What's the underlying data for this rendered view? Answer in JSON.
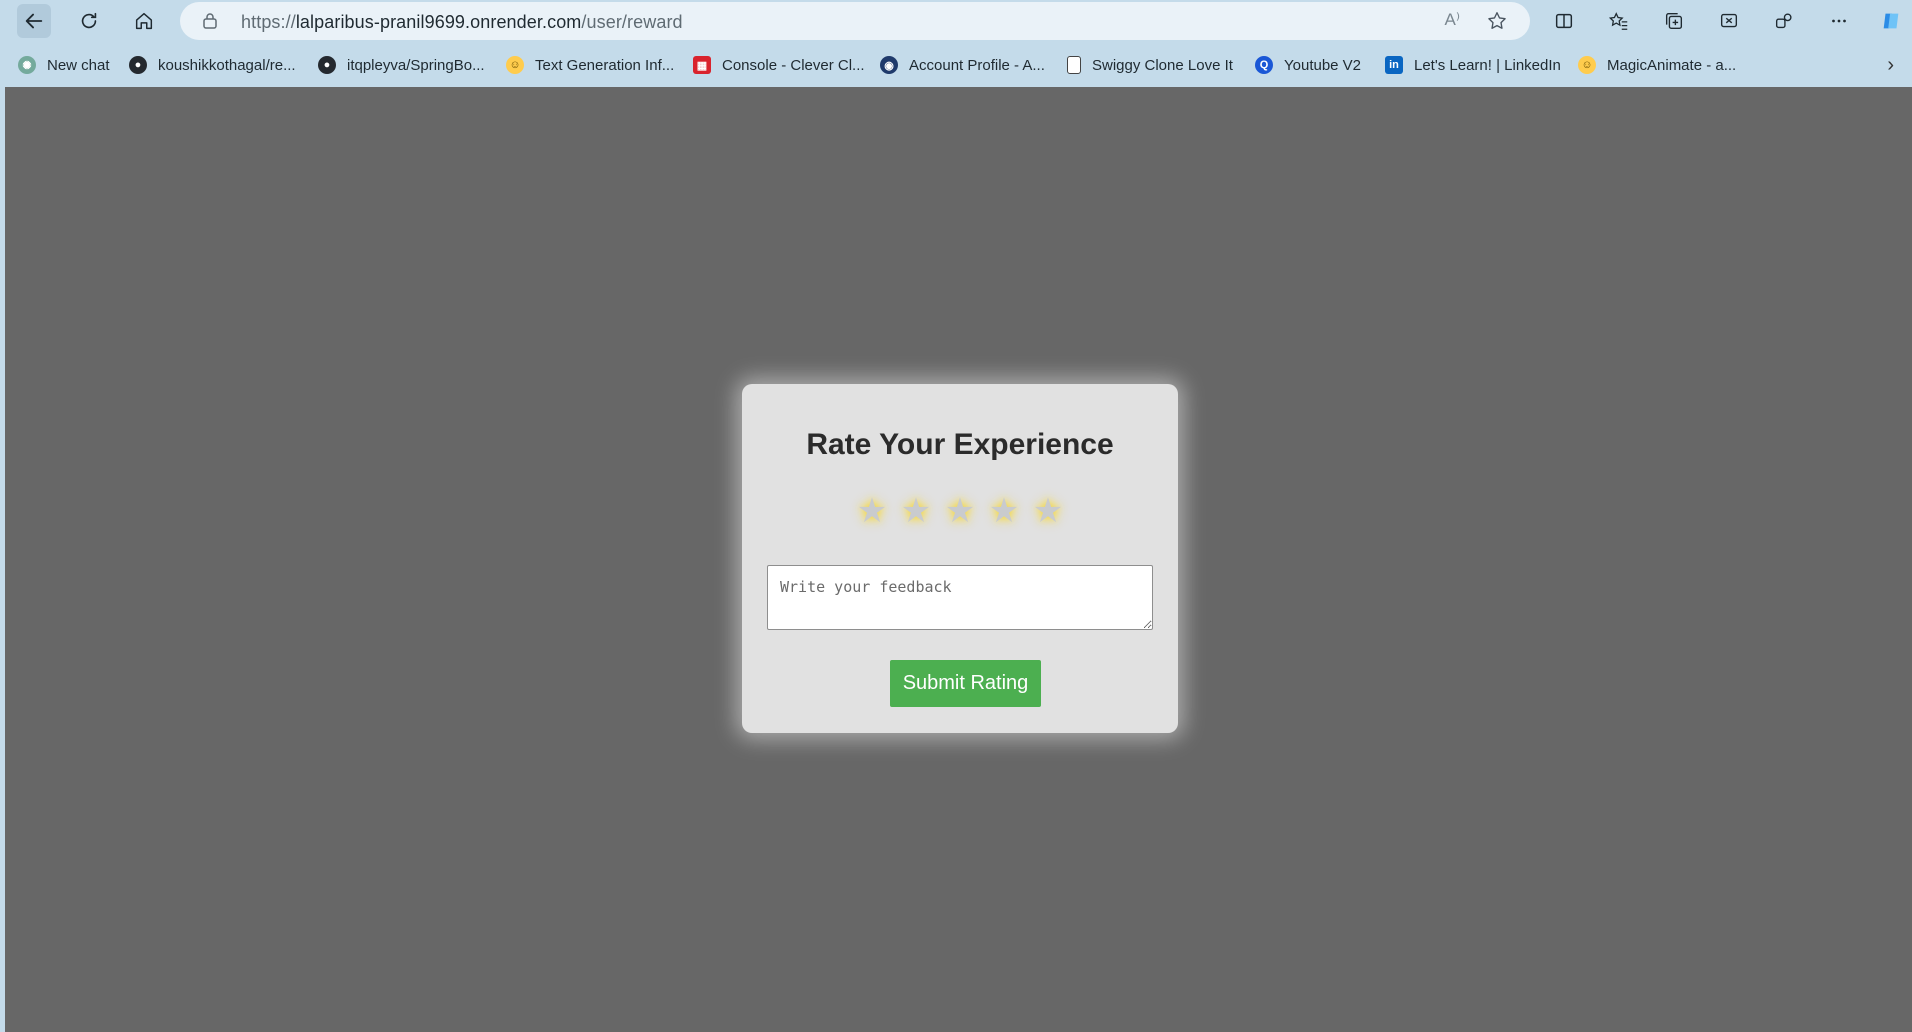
{
  "browser": {
    "url_scheme": "https://",
    "url_host": "lalparibus-pranil9699.onrender.com",
    "url_path": "/user/reward",
    "read_aloud_label": "A⁾",
    "icons": [
      "back-icon",
      "refresh-icon",
      "home-icon",
      "lock-icon",
      "read-aloud-icon",
      "favorite-star-icon",
      "split-screen-icon",
      "favorites-icon",
      "collections-icon",
      "screenshot-icon",
      "extensions-icon",
      "more-icon",
      "copilot-icon"
    ]
  },
  "bookmarks": [
    {
      "label": "New chat",
      "icon": "chatgpt-icon",
      "color": "#74aa9c"
    },
    {
      "label": "koushikkothagal/re...",
      "icon": "github-icon",
      "color": "#24292f"
    },
    {
      "label": "itqpleyva/SpringBo...",
      "icon": "github-icon",
      "color": "#24292f"
    },
    {
      "label": "Text Generation Inf...",
      "icon": "huggingface-icon",
      "color": "#ffcc4d"
    },
    {
      "label": "Console - Clever Cl...",
      "icon": "clever-cloud-icon",
      "color": "#d9232d"
    },
    {
      "label": "Account Profile - A...",
      "icon": "account-icon",
      "color": "#1f3a6b"
    },
    {
      "label": "Swiggy Clone Love It",
      "icon": "page-icon",
      "color": "#ffffff"
    },
    {
      "label": "Youtube V2",
      "icon": "youtube-v2-icon",
      "color": "#1a57d6"
    },
    {
      "label": "Let's Learn! | LinkedIn",
      "icon": "linkedin-icon",
      "color": "#0a66c2"
    },
    {
      "label": "MagicAnimate - a...",
      "icon": "huggingface-icon",
      "color": "#ffcc4d"
    }
  ],
  "page": {
    "title": "Rate Your Experience",
    "stars": [
      "★",
      "★",
      "★",
      "★",
      "★"
    ],
    "rating": 0,
    "rating_max": 5,
    "feedback_placeholder": "Write your feedback",
    "submit_label": "Submit Rating",
    "colors": {
      "background": "#676767",
      "card": "#e1e1e1",
      "button": "#4caf50",
      "star": "#c9cbce",
      "star_glow": "#ffd700"
    }
  }
}
